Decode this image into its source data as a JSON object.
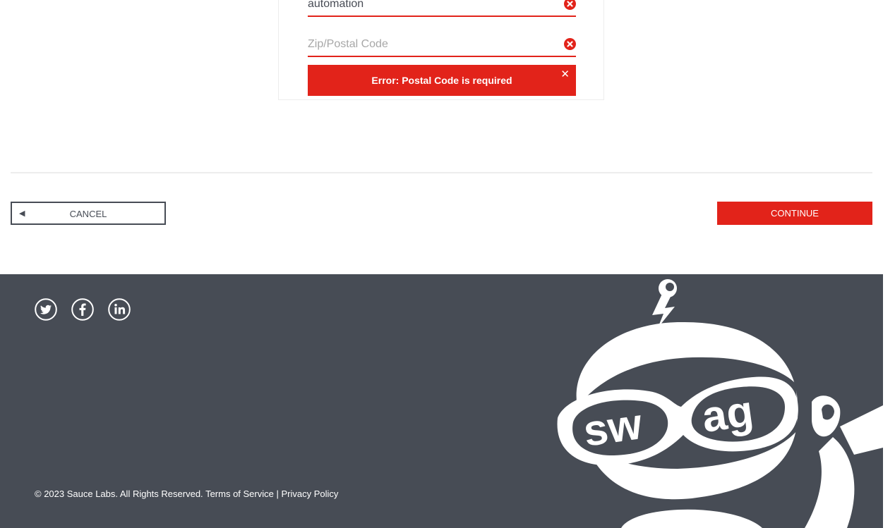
{
  "form": {
    "city_value": "automation",
    "zip_placeholder": "Zip/Postal Code",
    "error_message": "Error: Postal Code is required",
    "error_close": "✕"
  },
  "buttons": {
    "cancel_arrow": "◀",
    "cancel_label": "CANCEL",
    "continue_label": "CONTINUE"
  },
  "footer": {
    "copyright": "© 2023 Sauce Labs. All Rights Reserved.",
    "terms": "Terms of Service",
    "separator": "|",
    "privacy": "Privacy Policy",
    "social_icons": [
      "twitter-icon",
      "facebook-icon",
      "linkedin-icon"
    ],
    "logo_text": "swag"
  },
  "colors": {
    "accent_red": "#e2231a",
    "footer_bg": "#474c55",
    "text_dark": "#484c55"
  }
}
